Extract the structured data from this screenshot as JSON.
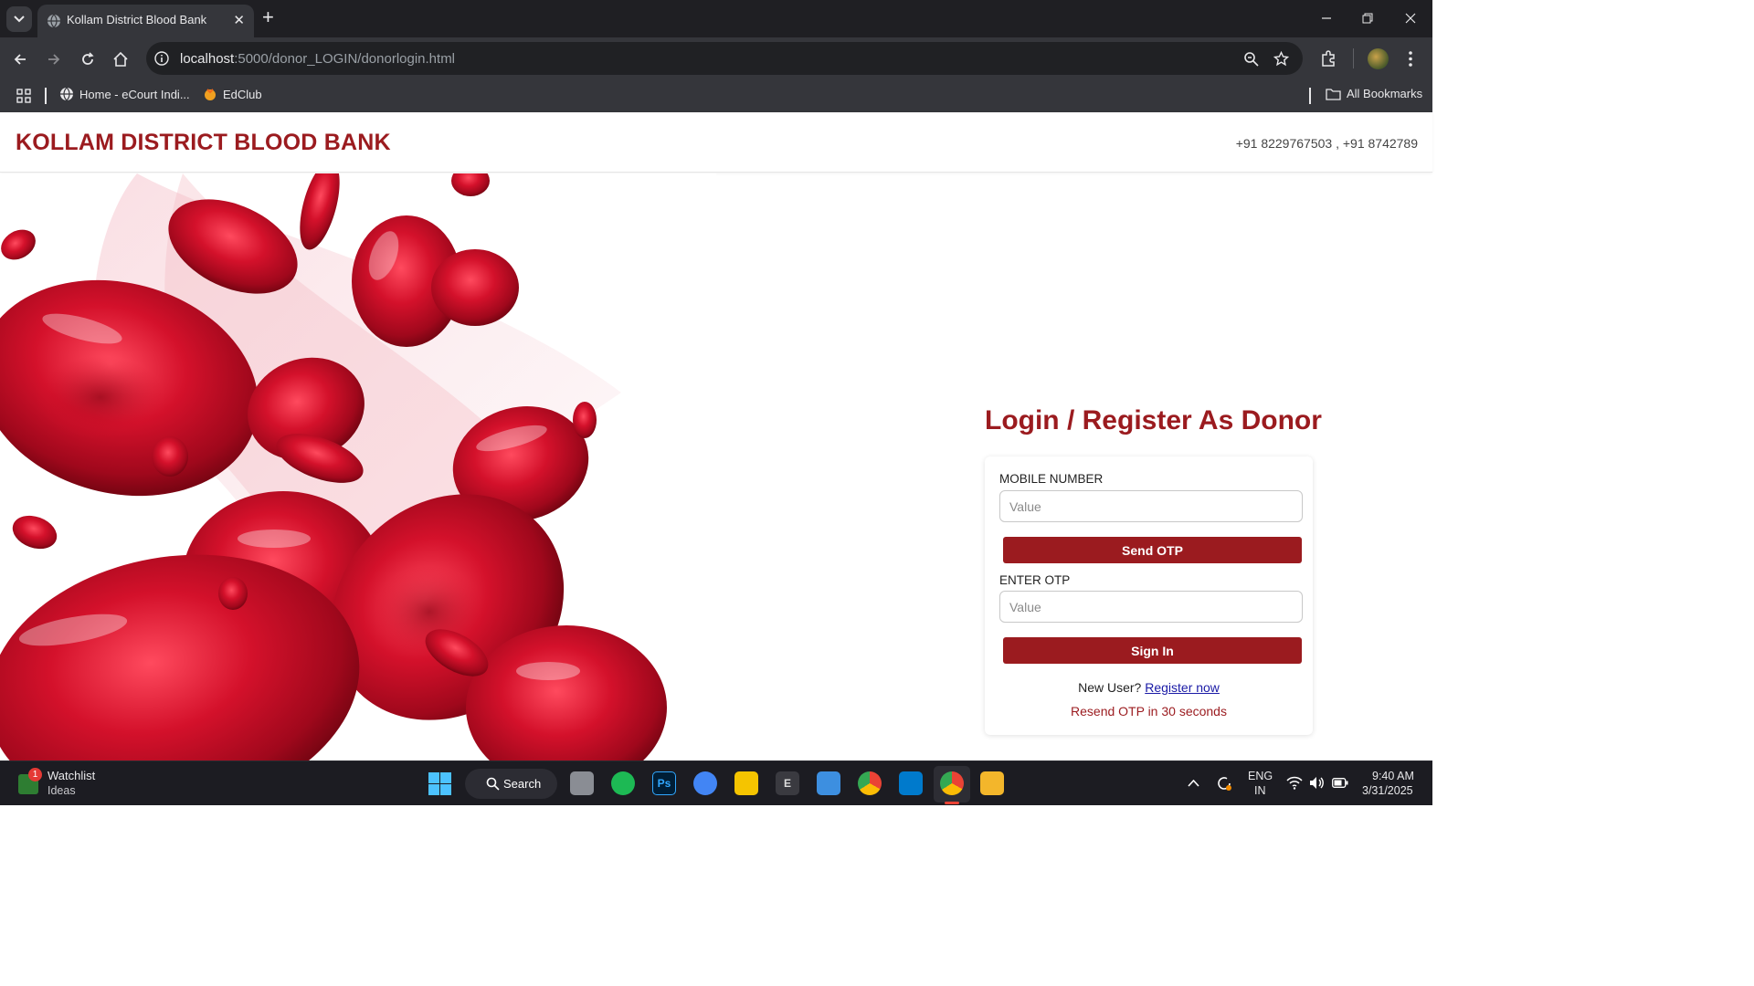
{
  "browser": {
    "tab_title": "Kollam District Blood Bank",
    "tab_close": "✕",
    "new_tab": "+",
    "url_host": "localhost",
    "url_rest": ":5000/donor_LOGIN/donorlogin.html",
    "bookmarks": {
      "item1": "Home - eCourt Indi...",
      "item2": "EdClub",
      "all": "All Bookmarks"
    }
  },
  "header": {
    "title": "KOLLAM DISTRICT BLOOD BANK",
    "phone": "+91 8229767503 , +91 8742789"
  },
  "login": {
    "heading": "Login / Register As Donor",
    "mobile_label": "MOBILE NUMBER",
    "mobile_placeholder": "Value",
    "send_otp": "Send OTP",
    "otp_label": "ENTER OTP",
    "otp_placeholder": "Value",
    "sign_in": "Sign In",
    "new_user": "New User?",
    "register_link": "Register now",
    "resend": "Resend OTP in 30 seconds"
  },
  "taskbar": {
    "watchlist_title": "Watchlist",
    "watchlist_sub": "Ideas",
    "badge": "1",
    "search": "Search",
    "ps": "Ps",
    "e_app": "E",
    "lang_top": "ENG",
    "lang_bottom": "IN",
    "time": "9:40 AM",
    "date": "3/31/2025"
  },
  "colors": {
    "brand": "#9b1b1f",
    "chrome_dark": "#1f1f23",
    "chrome": "#35363b",
    "blood": "#c8102e"
  }
}
